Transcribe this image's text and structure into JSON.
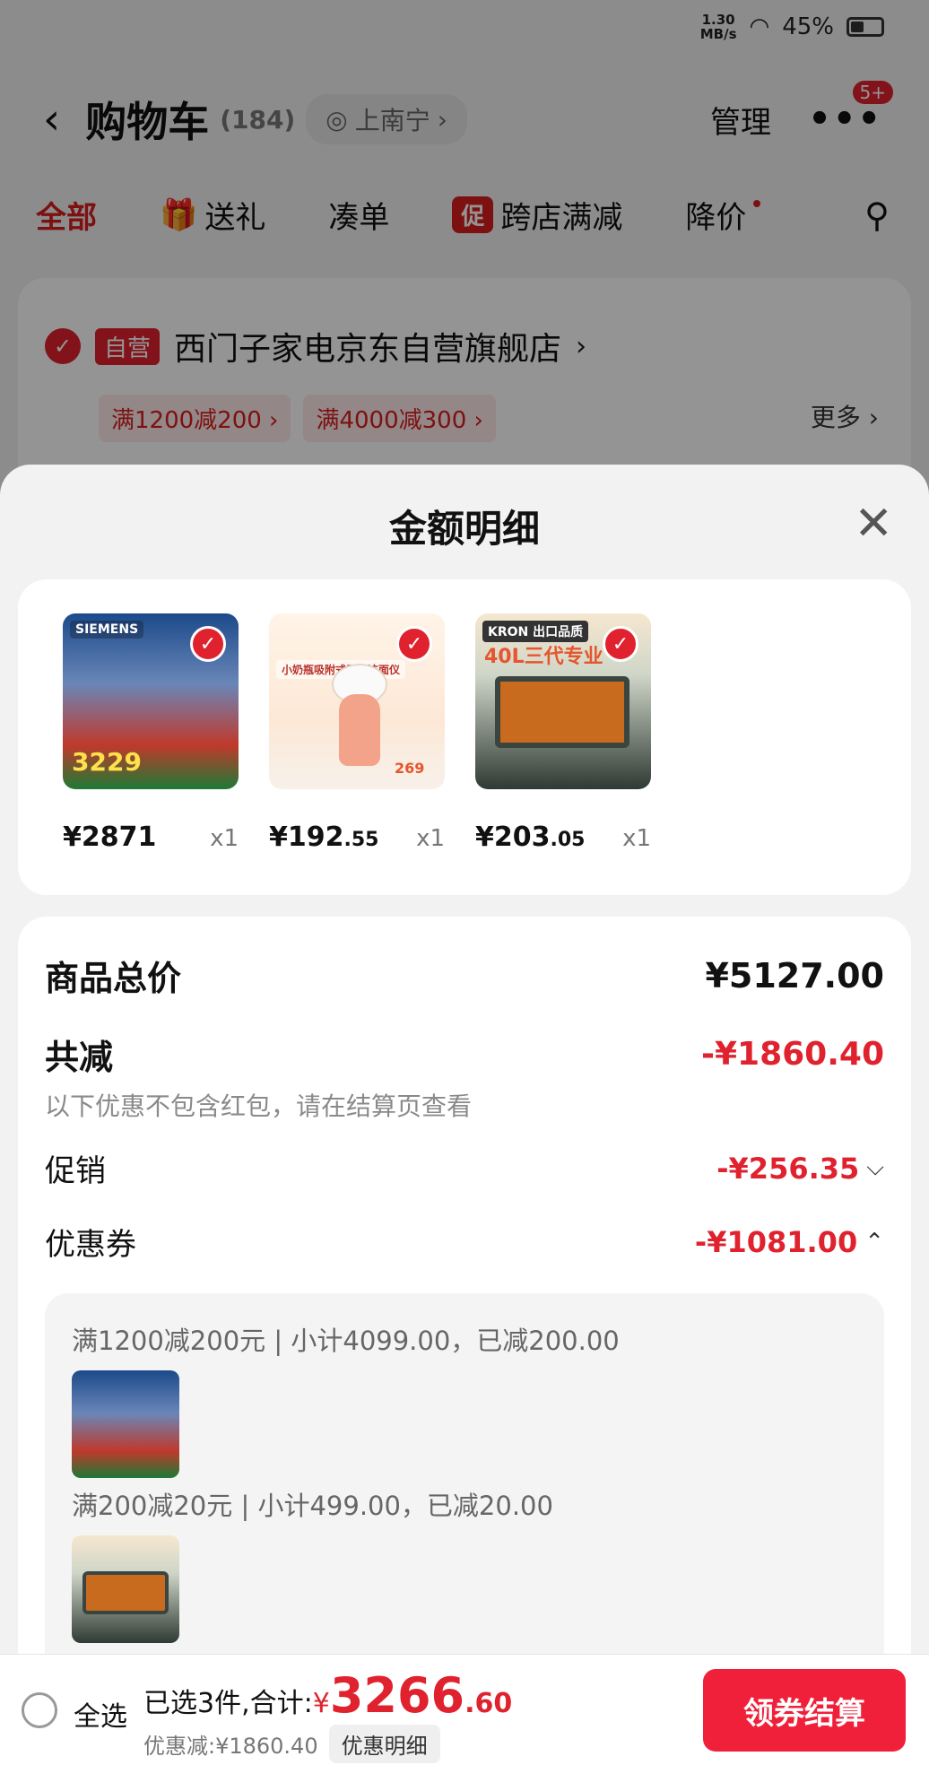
{
  "status": {
    "speed_value": "1.30",
    "speed_unit": "MB/s",
    "battery": "45%"
  },
  "header": {
    "title": "购物车",
    "count": "(184)",
    "location": "上南宁",
    "manage": "管理",
    "badge": "5+"
  },
  "tabs": [
    {
      "label": "全部"
    },
    {
      "label": "送礼"
    },
    {
      "label": "凑单"
    },
    {
      "label": "跨店满减",
      "tag": "促"
    },
    {
      "label": "降价"
    }
  ],
  "store": {
    "tag": "自营",
    "name": "西门子家电京东自营旗舰店",
    "coupons": [
      "满1200减200",
      "满4000减300"
    ],
    "more": "更多"
  },
  "sheet": {
    "title": "金额明细",
    "products": [
      {
        "price_int": "¥2871",
        "price_dec": "",
        "qty": "x1",
        "brand": "SIEMENS",
        "promo": "3229",
        "icon": "dishwasher-image"
      },
      {
        "price_int": "¥192",
        "price_dec": ".55",
        "qty": "x1",
        "brand": "小奶瓶吸附式震动洁面仪",
        "promo": "269",
        "icon": "cleanser-image"
      },
      {
        "price_int": "¥203",
        "price_dec": ".05",
        "qty": "x1",
        "brand": "KRON 出口品质",
        "promo": "40L三代专业",
        "icon": "oven-image"
      }
    ],
    "total_label": "商品总价",
    "total_value": "¥5127.00",
    "reduce_label": "共减",
    "reduce_value": "-¥1860.40",
    "reduce_note": "以下优惠不包含红包，请在结算页查看",
    "promo_label": "促销",
    "promo_value": "-¥256.35",
    "coupon_label": "优惠券",
    "coupon_value": "-¥1081.00",
    "coupon_lines": [
      "满1200减200元 | 小计4099.00，已减200.00",
      "满200减20元 | 小计499.00，已减20.00"
    ]
  },
  "bottom": {
    "select_all": "全选",
    "selected": "已选3件,合计:",
    "currency": "¥",
    "amount": "3266",
    "decimal": ".60",
    "discount": "优惠减:¥1860.40",
    "detail_button": "优惠明细",
    "pay_button": "领券结算"
  }
}
